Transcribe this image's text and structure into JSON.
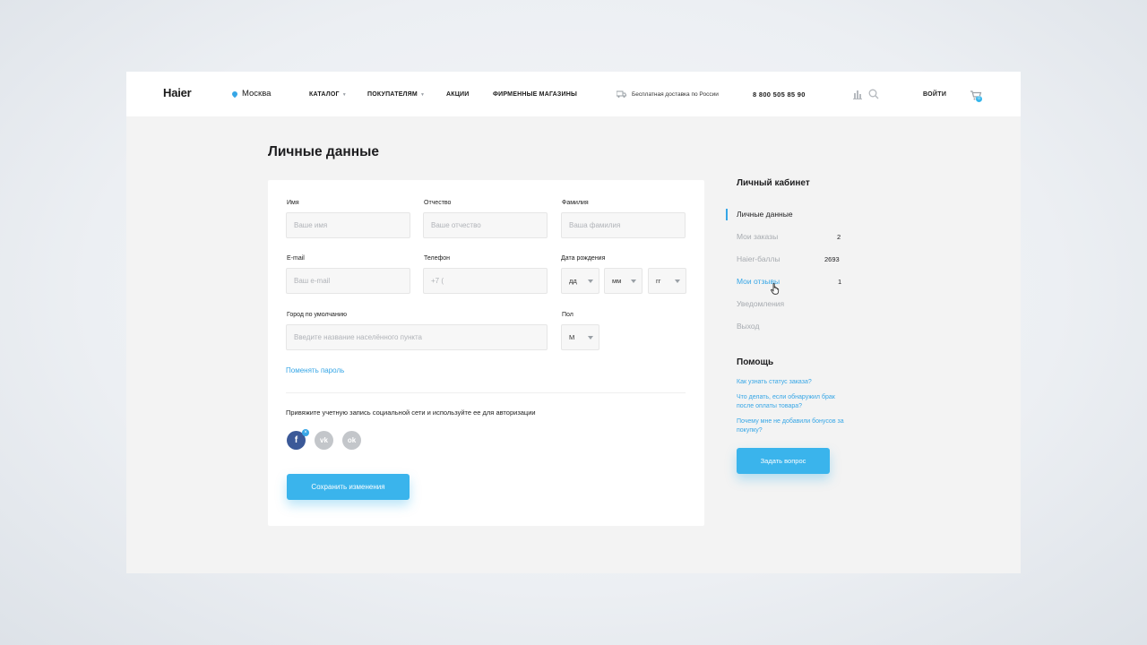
{
  "header": {
    "logo": "Haier",
    "city": "Москва",
    "nav": [
      {
        "label": "КАТАЛОГ",
        "has_caret": true
      },
      {
        "label": "ПОКУПАТЕЛЯМ",
        "has_caret": true
      },
      {
        "label": "АКЦИИ",
        "has_caret": false
      },
      {
        "label": "ФИРМЕННЫЕ МАГАЗИНЫ",
        "has_caret": false
      }
    ],
    "delivery": "Бесплатная доставка по России",
    "phone": "8 800 505 85 90",
    "login": "ВОЙТИ",
    "cart_count": "0"
  },
  "page_title": "Личные данные",
  "form": {
    "first_name": {
      "label": "Имя",
      "placeholder": "Ваше имя"
    },
    "middle_name": {
      "label": "Отчество",
      "placeholder": "Ваше отчество"
    },
    "last_name": {
      "label": "Фамилия",
      "placeholder": "Ваша фамилия"
    },
    "email": {
      "label": "E-mail",
      "placeholder": "Ваш e-mail"
    },
    "phone": {
      "label": "Телефон",
      "placeholder": "+7 ("
    },
    "birth": {
      "label": "Дата рождения",
      "day": "дд",
      "month": "мм",
      "year": "гг"
    },
    "city": {
      "label": "Город по умолчанию",
      "placeholder": "Введите название населённого пункта"
    },
    "gender": {
      "label": "Пол",
      "value": "М"
    },
    "change_password": "Поменять пароль",
    "social_text": "Привяжите учетную запись социальной сети и используйте ее для авторизации",
    "social": {
      "facebook": "f",
      "vk": "vk",
      "ok": "ok",
      "remove": "×"
    },
    "save": "Сохранить изменения"
  },
  "sidebar": {
    "title": "Личный кабинет",
    "items": [
      {
        "label": "Личные данные",
        "count": ""
      },
      {
        "label": "Мои заказы",
        "count": "2"
      },
      {
        "label": "Haier-баллы",
        "count": "2693"
      },
      {
        "label": "Мои отзывы",
        "count": "1"
      },
      {
        "label": "Уведомления",
        "count": ""
      },
      {
        "label": "Выход",
        "count": ""
      }
    ],
    "help_title": "Помощь",
    "help_links": [
      "Как узнать статус заказа?",
      "Что делать, если обнаружил брак после оплаты товара?",
      "Почему мне не добавили бонусов за покупку?"
    ],
    "ask_button": "Задать вопрос"
  },
  "colors": {
    "accent": "#36a6e6",
    "button": "#3ab4ec",
    "muted": "#a7abb0"
  }
}
